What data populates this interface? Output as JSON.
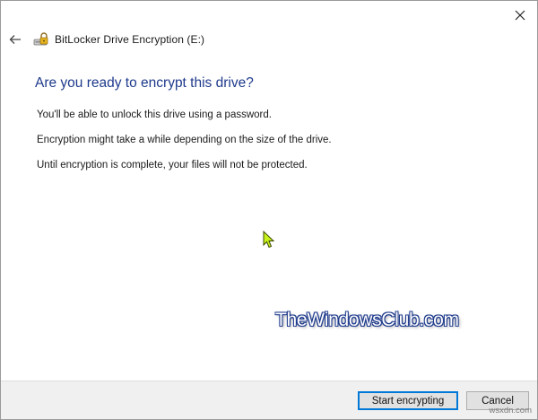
{
  "window": {
    "title": "BitLocker Drive Encryption (E:)",
    "close_icon": "close-icon",
    "back_icon": "back-arrow-icon",
    "app_icon": "bitlocker-drive-icon"
  },
  "main": {
    "heading": "Are you ready to encrypt this drive?",
    "paragraphs": [
      "You'll be able to unlock this drive using a password.",
      "Encryption might take a while depending on the size of the drive.",
      "Until encryption is complete, your files will not be protected."
    ]
  },
  "footer": {
    "start_button_label": "Start encrypting",
    "cancel_button_label": "Cancel"
  },
  "watermark": {
    "logo_text": "TheWindowsClub.com",
    "site_text": "wsxdn.com"
  },
  "colors": {
    "heading": "#1e3a8c",
    "primary_border": "#0078d7",
    "footer_bg": "#f0f0f0",
    "cursor": "#c8f21a"
  }
}
